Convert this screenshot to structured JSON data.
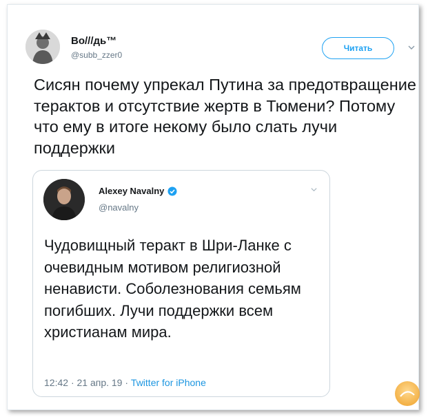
{
  "tweet": {
    "display_name": "Во///дь™",
    "handle": "@subb_zzer0",
    "follow_label": "Читать",
    "text": "Сисян почему упрекал Путина за предотвращение терактов и отсутствие жертв в Тюмени? Потому что ему в итоге некому было слать лучи поддержки"
  },
  "quoted": {
    "display_name": "Alexey Navalny",
    "handle": "@navalny",
    "text": "Чудовищный теракт в Шри-Ланке с очевидным мотивом религиозной ненависти. Соболезнования семьям погибших. Лучи поддержки всем христианам мира.",
    "time": "12:42",
    "date": "21 апр. 19",
    "separator": "·",
    "source": "Twitter for iPhone"
  },
  "colors": {
    "accent": "#1da1f2",
    "text": "#14171a",
    "muted": "#657786",
    "border": "#ccd6dd"
  },
  "icons": {
    "caret": "chevron-down-icon",
    "verified": "verified-badge-icon"
  }
}
